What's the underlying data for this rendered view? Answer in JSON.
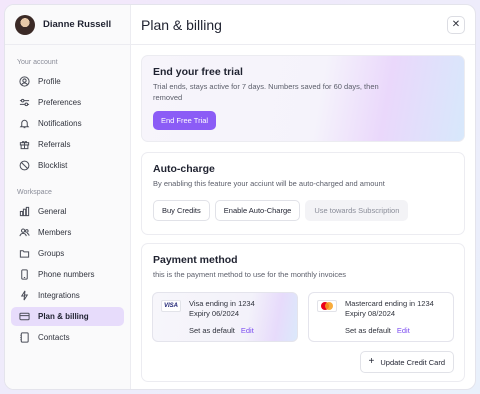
{
  "user": {
    "name": "Dianne Russell"
  },
  "sidebar": {
    "account_label": "Your account",
    "account_items": [
      {
        "label": "Profile",
        "icon": "user-circle-icon"
      },
      {
        "label": "Preferences",
        "icon": "sliders-icon"
      },
      {
        "label": "Notifications",
        "icon": "bell-icon"
      },
      {
        "label": "Referrals",
        "icon": "gift-icon"
      },
      {
        "label": "Blocklist",
        "icon": "block-icon"
      }
    ],
    "workspace_label": "Workspace",
    "workspace_items": [
      {
        "label": "General",
        "icon": "chart-icon"
      },
      {
        "label": "Members",
        "icon": "users-icon"
      },
      {
        "label": "Groups",
        "icon": "folder-icon"
      },
      {
        "label": "Phone numbers",
        "icon": "phone-icon"
      },
      {
        "label": "Integrations",
        "icon": "plug-icon"
      },
      {
        "label": "Plan & billing",
        "icon": "credit-card-icon",
        "active": true
      },
      {
        "label": "Contacts",
        "icon": "book-icon"
      }
    ]
  },
  "header": {
    "title": "Plan & billing",
    "close_icon": "close-icon"
  },
  "trial": {
    "title": "End your free trial",
    "description": "Trial ends, stays active for 7 days. Numbers saved for 60 days, then removed",
    "button": "End Free Trial"
  },
  "autocharge": {
    "title": "Auto-charge",
    "description": "By enabling this feature your acciunt will be auto-charged and amount",
    "buttons": [
      "Buy Credits",
      "Enable Auto-Charge",
      "Use towards Subscription"
    ]
  },
  "payment": {
    "title": "Payment method",
    "description": "this is the payment method to use for the monthly invoices",
    "cards": [
      {
        "brand": "VISA",
        "name": "Visa ending in 1234",
        "expiry": "Expiry 06/2024",
        "default_label": "Set as default",
        "edit_label": "Edit"
      },
      {
        "brand": "mastercard",
        "name": "Mastercard ending in 1234",
        "expiry": "Expiry 08/2024",
        "default_label": "Set as default",
        "edit_label": "Edit"
      }
    ],
    "update_button": "Update Credit Card"
  },
  "colors": {
    "accent": "#8b5cf6",
    "active_nav": "#e7dcfb"
  }
}
